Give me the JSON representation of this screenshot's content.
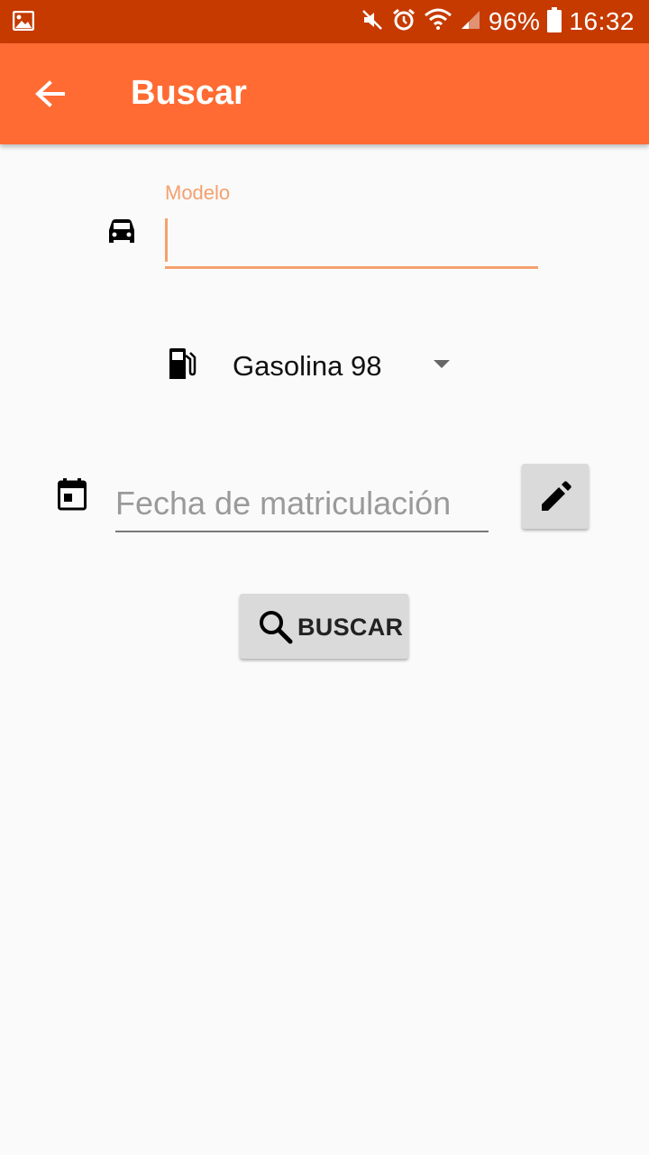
{
  "status_bar": {
    "battery": "96%",
    "time": "16:32"
  },
  "app_bar": {
    "title": "Buscar"
  },
  "form": {
    "modelo": {
      "label": "Modelo",
      "value": ""
    },
    "fuel": {
      "selected": "Gasolina 98"
    },
    "fecha": {
      "placeholder": "Fecha de matriculación",
      "value": ""
    },
    "search_button_label": "BUSCAR"
  },
  "icons": {
    "gallery": "gallery-icon",
    "mute": "mute-icon",
    "alarm": "alarm-icon",
    "wifi": "wifi-icon",
    "signal": "signal-icon",
    "battery": "battery-icon",
    "back": "arrow-back-icon",
    "car": "car-icon",
    "fuel": "gas-station-icon",
    "calendar": "calendar-icon",
    "edit": "pencil-icon",
    "search": "search-icon"
  },
  "colors": {
    "status_bar": "#c63a00",
    "app_bar": "#ff6b32",
    "accent": "#f5a06e",
    "background": "#fafafa",
    "button": "#dadada"
  }
}
